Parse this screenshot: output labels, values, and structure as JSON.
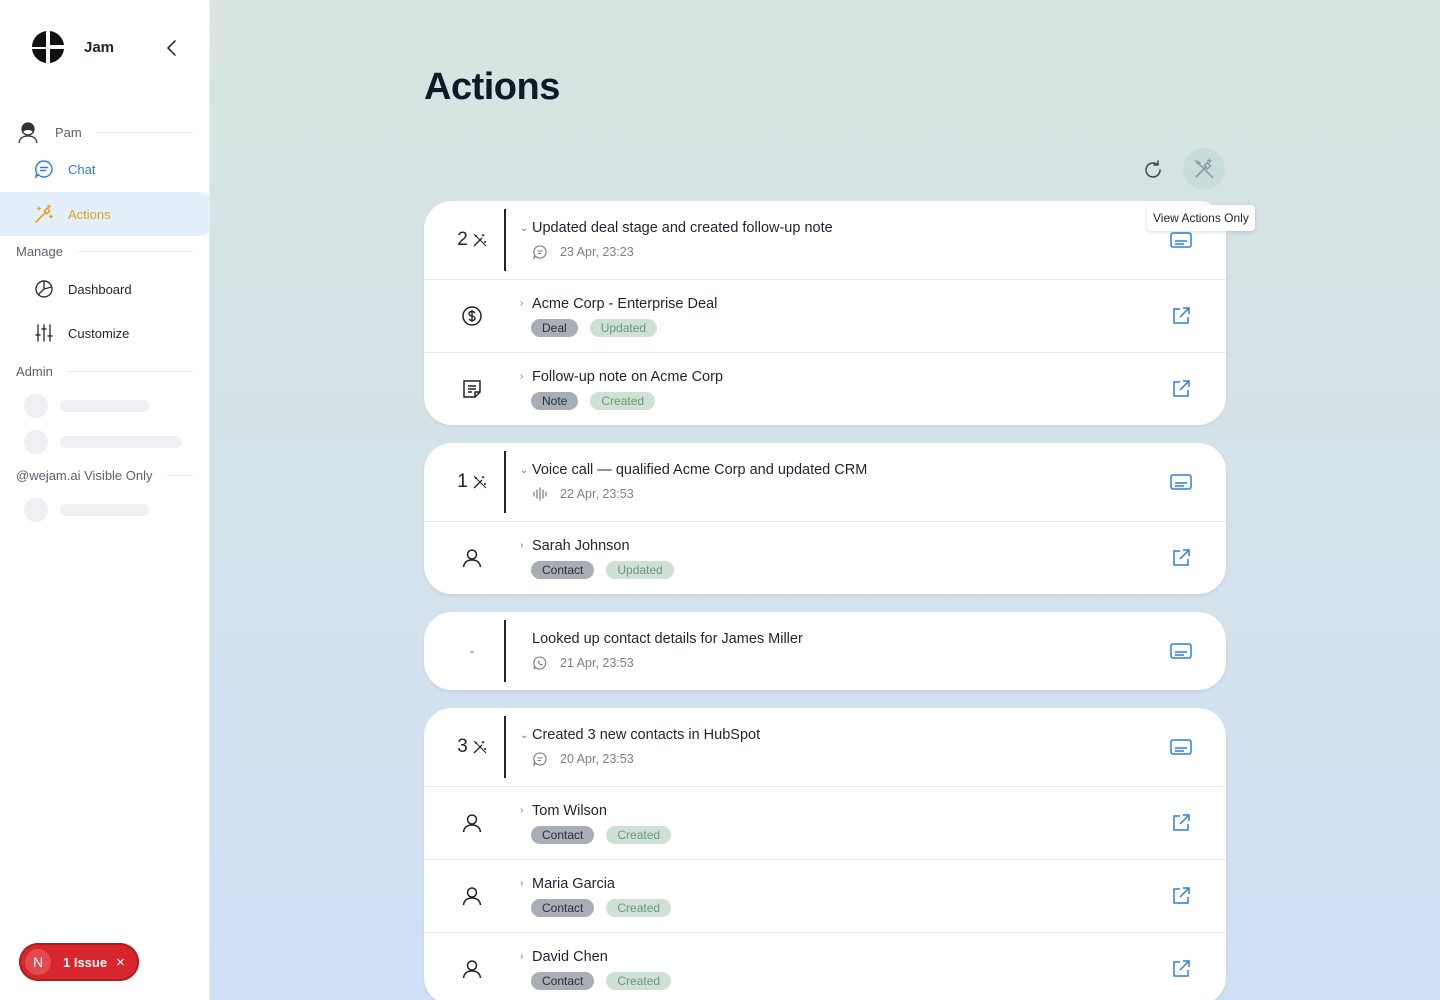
{
  "app": {
    "name": "Jam"
  },
  "sidebar": {
    "user": "Pam",
    "items": [
      {
        "label": "Chat"
      },
      {
        "label": "Actions"
      }
    ],
    "manage_label": "Manage",
    "manage_items": [
      {
        "label": "Dashboard"
      },
      {
        "label": "Customize"
      }
    ],
    "admin_label": "Admin",
    "visible_only_label": "@wejam.ai Visible Only"
  },
  "issue_badge": {
    "initial": "N",
    "text": "1 Issue",
    "close": "×"
  },
  "page": {
    "title": "Actions",
    "tooltip": "View Actions Only"
  },
  "groups": [
    {
      "count": "2",
      "title": "Updated deal stage and created follow-up note",
      "source_icon": "chat-bubble-icon",
      "timestamp": "23 Apr, 23:23",
      "items": [
        {
          "icon": "dollar-icon",
          "title": "Acme Corp - Enterprise Deal",
          "type": "Deal",
          "status": "Updated"
        },
        {
          "icon": "note-icon",
          "title": "Follow-up note on Acme Corp",
          "type": "Note",
          "status": "Created"
        }
      ]
    },
    {
      "count": "1",
      "title": "Voice call — qualified Acme Corp and updated CRM",
      "source_icon": "audio-wave-icon",
      "timestamp": "22 Apr, 23:53",
      "items": [
        {
          "icon": "person-icon",
          "title": "Sarah Johnson",
          "type": "Contact",
          "status": "Updated"
        }
      ]
    },
    {
      "count": "-",
      "title": "Looked up contact details for James Miller",
      "source_icon": "whatsapp-icon",
      "timestamp": "21 Apr, 23:53",
      "items": []
    },
    {
      "count": "3",
      "title": "Created 3 new contacts in HubSpot",
      "source_icon": "chat-bubble-icon",
      "timestamp": "20 Apr, 23:53",
      "items": [
        {
          "icon": "person-icon",
          "title": "Tom Wilson",
          "type": "Contact",
          "status": "Created"
        },
        {
          "icon": "person-icon",
          "title": "Maria Garcia",
          "type": "Contact",
          "status": "Created"
        },
        {
          "icon": "person-icon",
          "title": "David Chen",
          "type": "Contact",
          "status": "Created"
        }
      ]
    }
  ],
  "colors": {
    "accent_blue": "#2f7fd8",
    "accent_gold": "#e0a21a",
    "tag_type_bg": "#a8adb6",
    "tag_status_bg": "#cfe0d6",
    "issue_red": "#d9252d"
  }
}
